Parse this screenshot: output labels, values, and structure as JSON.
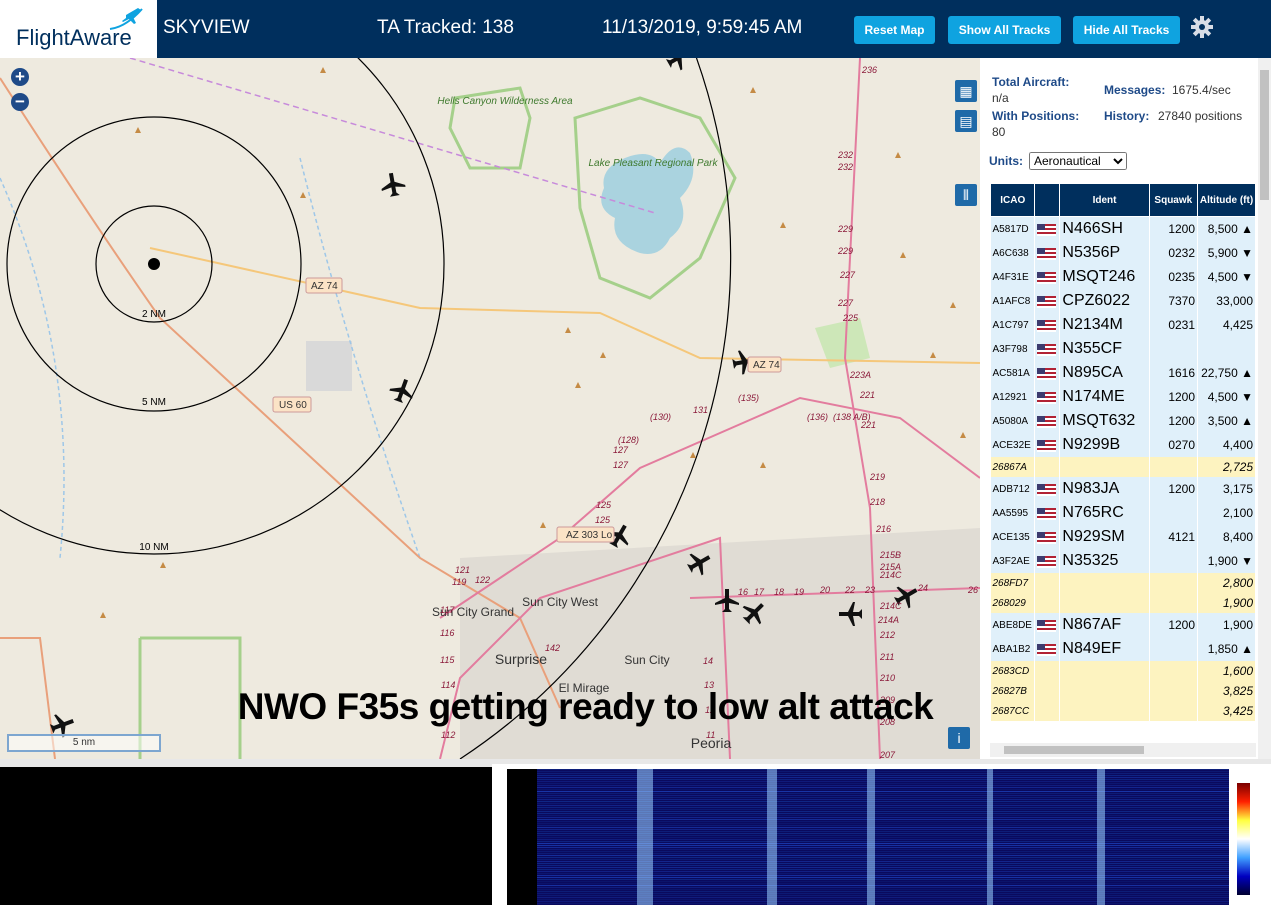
{
  "header": {
    "logo": "FlightAware",
    "app_title": "SKYVIEW",
    "tracked": "TA Tracked: 138",
    "datetime": "11/13/2019, 9:59:45 AM",
    "buttons": {
      "reset": "Reset Map",
      "show": "Show All Tracks",
      "hide": "Hide All Tracks"
    },
    "colors": {
      "bar": "#002f5d",
      "button": "#0fa3e0"
    }
  },
  "map": {
    "range_rings": [
      "2 NM",
      "5 NM",
      "10 NM"
    ],
    "scale": "5 nm",
    "overlay_caption": "NWO F35s getting ready to low alt attack",
    "places": [
      "Hells Canyon Wilderness Area",
      "Lake Pleasant Regional Park",
      "Sun City Grand",
      "Sun City West",
      "Surprise",
      "Sun City",
      "El Mirage",
      "Peoria"
    ],
    "road_shields": [
      "AZ 74",
      "AZ 74",
      "US 60",
      "AZ 303 Lo"
    ],
    "route_numbers": [
      "236",
      "232",
      "232",
      "229",
      "229",
      "227",
      "227",
      "225",
      "223A",
      "221",
      "221",
      "219",
      "218",
      "216",
      "215B",
      "215A",
      "214C",
      "214A",
      "214C",
      "212",
      "211",
      "210",
      "209",
      "208",
      "207",
      "131",
      "(135)",
      "(136)",
      "(138 A/B)",
      "(130)",
      "(128)",
      "127",
      "127",
      "125",
      "125",
      "122",
      "121",
      "119",
      "117",
      "116",
      "115",
      "114",
      "112",
      "142",
      "16",
      "17",
      "18",
      "19",
      "20",
      "22",
      "23",
      "24",
      "26",
      "14",
      "13",
      "12",
      "11"
    ]
  },
  "panel": {
    "total_aircraft_label": "Total Aircraft:",
    "total_aircraft": "n/a",
    "messages_label": "Messages:",
    "messages": "1675.4/sec",
    "with_positions_label": "With Positions:",
    "with_positions": "80",
    "history_label": "History:",
    "history": "27840 positions",
    "units_label": "Units:",
    "units_value": "Aeronautical",
    "columns": {
      "icao": "ICAO",
      "ident": "Ident",
      "squawk": "Squawk",
      "altitude": "Altitude (ft)"
    },
    "rows": [
      {
        "icao": "A5817D",
        "ident": "N466SH",
        "squawk": "1200",
        "alt": "8,500 ▲",
        "mil": false
      },
      {
        "icao": "A6C638",
        "ident": "N5356P",
        "squawk": "0232",
        "alt": "5,900 ▼",
        "mil": false
      },
      {
        "icao": "A4F31E",
        "ident": "MSQT246",
        "squawk": "0235",
        "alt": "4,500 ▼",
        "mil": false
      },
      {
        "icao": "A1AFC8",
        "ident": "CPZ6022",
        "squawk": "7370",
        "alt": "33,000",
        "mil": false
      },
      {
        "icao": "A1C797",
        "ident": "N2134M",
        "squawk": "0231",
        "alt": "4,425",
        "mil": false
      },
      {
        "icao": "A3F798",
        "ident": "N355CF",
        "squawk": "",
        "alt": "",
        "mil": false
      },
      {
        "icao": "AC581A",
        "ident": "N895CA",
        "squawk": "1616",
        "alt": "22,750 ▲",
        "mil": false
      },
      {
        "icao": "A12921",
        "ident": "N174ME",
        "squawk": "1200",
        "alt": "4,500 ▼",
        "mil": false
      },
      {
        "icao": "A5080A",
        "ident": "MSQT632",
        "squawk": "1200",
        "alt": "3,500 ▲",
        "mil": false
      },
      {
        "icao": "ACE32E",
        "ident": "N9299B",
        "squawk": "0270",
        "alt": "4,400",
        "mil": false
      },
      {
        "icao": "26867A",
        "ident": "",
        "squawk": "",
        "alt": "2,725",
        "mil": true
      },
      {
        "icao": "ADB712",
        "ident": "N983JA",
        "squawk": "1200",
        "alt": "3,175",
        "mil": false
      },
      {
        "icao": "AA5595",
        "ident": "N765RC",
        "squawk": "",
        "alt": "2,100",
        "mil": false
      },
      {
        "icao": "ACE135",
        "ident": "N929SM",
        "squawk": "4121",
        "alt": "8,400",
        "mil": false
      },
      {
        "icao": "A3F2AE",
        "ident": "N35325",
        "squawk": "",
        "alt": "1,900 ▼",
        "mil": false
      },
      {
        "icao": "268FD7",
        "ident": "",
        "squawk": "",
        "alt": "2,800",
        "mil": true
      },
      {
        "icao": "268029",
        "ident": "",
        "squawk": "",
        "alt": "1,900",
        "mil": true
      },
      {
        "icao": "ABE8DE",
        "ident": "N867AF",
        "squawk": "1200",
        "alt": "1,900",
        "mil": false
      },
      {
        "icao": "ABA1B2",
        "ident": "N849EF",
        "squawk": "",
        "alt": "1,850 ▲",
        "mil": false
      },
      {
        "icao": "2683CD",
        "ident": "",
        "squawk": "",
        "alt": "1,600",
        "mil": true
      },
      {
        "icao": "26827B",
        "ident": "",
        "squawk": "",
        "alt": "3,825",
        "mil": true
      },
      {
        "icao": "2687CC",
        "ident": "",
        "squawk": "",
        "alt": "3,425",
        "mil": true
      }
    ]
  },
  "icons": [
    "zoom-in-icon",
    "zoom-out-icon",
    "map-layers-icon",
    "grid-icon",
    "columns-icon",
    "info-icon",
    "gear-icon",
    "aircraft-icon",
    "us-flag-icon"
  ]
}
